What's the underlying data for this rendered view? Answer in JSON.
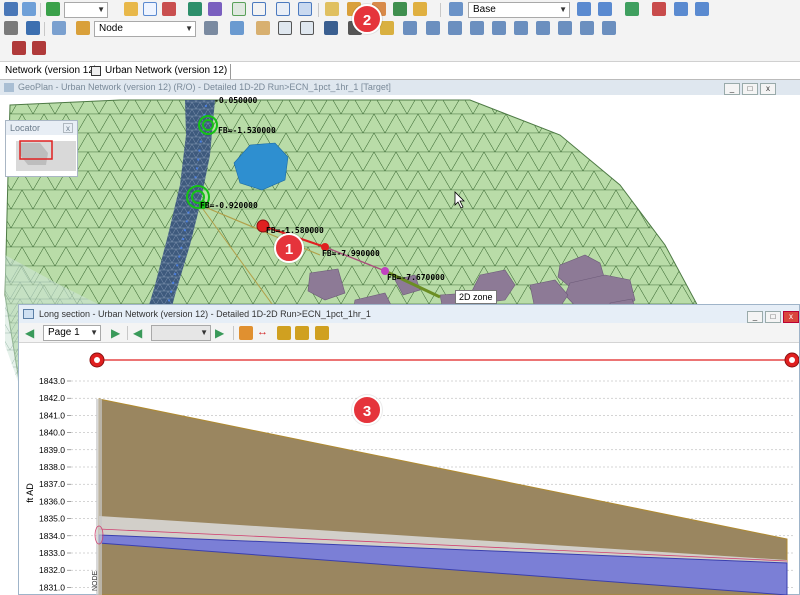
{
  "toolbar": {
    "row1": {
      "blank_combo_1": "",
      "base_combo": "Base"
    },
    "row2": {
      "layer_combo": "Node"
    }
  },
  "tabs": [
    {
      "label": "Network (version 12)"
    },
    {
      "label": "Urban Network (version 12)"
    }
  ],
  "geoplan": {
    "title": "GeoPlan - Urban Network (version 12) (R/O) - Detailed 1D-2D Run>ECN_1pct_1hr_1  [Target]",
    "locator": {
      "title": "Locator",
      "close": "x"
    },
    "tooltip": "2D zone",
    "labels": {
      "fb1": "FB=-1.530000",
      "fb2": "FB=-0.920000",
      "fb3": "FB=-1.580000",
      "fb4": "FB=-7.990000",
      "fb5": "FB=-7.670000",
      "fb0": "-0.050000"
    }
  },
  "badges": {
    "b1": "1",
    "b2": "2",
    "b3": "3"
  },
  "long_section": {
    "title": "Long section - Urban Network (version 12) - Detailed 1D-2D Run>ECN_1pct_1hr_1",
    "page_combo": "Page 1",
    "blank_combo": "",
    "ylabel": "ft AD",
    "y_ticks": [
      "1843.0",
      "1842.0",
      "1841.0",
      "1840.0",
      "1839.0",
      "1838.0",
      "1837.0",
      "1836.0",
      "1835.0",
      "1834.0",
      "1833.0",
      "1832.0",
      "1831.0"
    ],
    "left_node_label": "NODE"
  },
  "window_buttons": {
    "min": "_",
    "max": "□",
    "close": "x"
  },
  "colors": {
    "mesh_fill": "#b9dca8",
    "mesh_line": "#3f6b3a",
    "river": "#3e5a7d",
    "pond": "#2e8fd0",
    "building": "#8d7a96",
    "link_red": "#e02020",
    "ground_fill": "#9a8660",
    "pipe_fill": "#7b7fd6",
    "badge": "#e5343b"
  }
}
